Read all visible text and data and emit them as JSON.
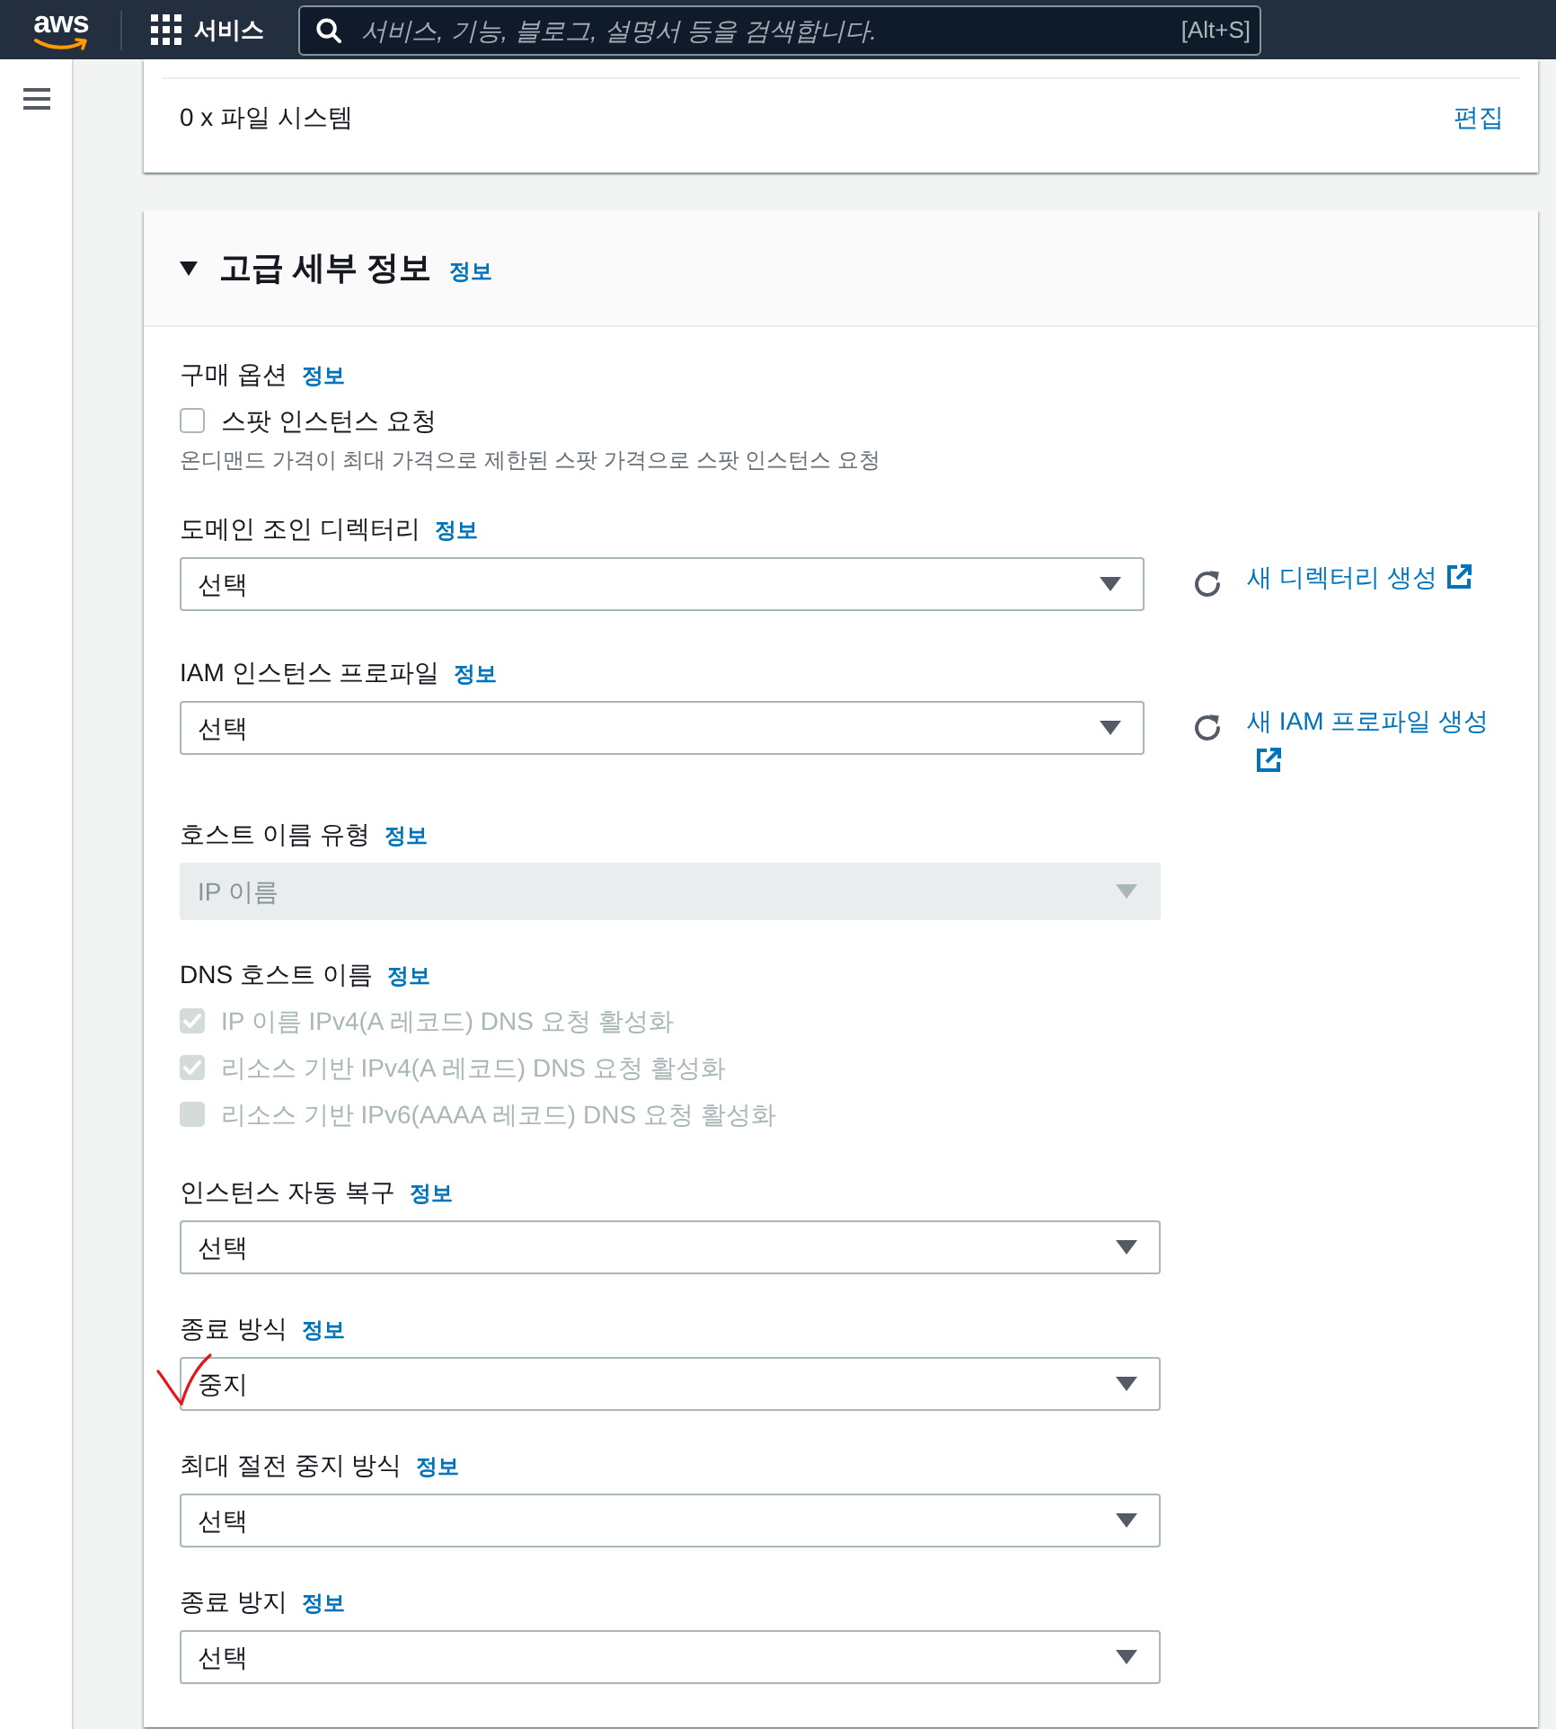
{
  "top_nav": {
    "logo_text": "aws",
    "services": "서비스",
    "search": {
      "placeholder": "서비스, 기능, 블로그, 설명서 등을 검색합니다.",
      "shortcut": "[Alt+S]"
    }
  },
  "storage_summary": {
    "text": "0 x 파일 시스템",
    "edit_link": "편집"
  },
  "advanced_details": {
    "title": "고급 세부 정보",
    "info": "정보",
    "expanded": true,
    "fields": [
      {
        "kind": "checkboxes",
        "label": "구매 옵션",
        "info": "정보",
        "options": [
          {
            "label": "스팟 인스턴스 요청",
            "checked": false,
            "disabled": false
          }
        ],
        "description": "온디맨드 가격이 최대 가격으로 제한된 스팟 가격으로 스팟 인스턴스 요청"
      },
      {
        "kind": "select",
        "label": "도메인 조인 디렉터리",
        "info": "정보",
        "value": "선택",
        "disabled": false,
        "create_link": "새 디렉터리 생성"
      },
      {
        "kind": "select",
        "label": "IAM 인스턴스 프로파일",
        "info": "정보",
        "value": "선택",
        "disabled": false,
        "create_link": "새 IAM 프로파일 생성"
      },
      {
        "kind": "select",
        "label": "호스트 이름 유형",
        "info": "정보",
        "value": "IP 이름",
        "disabled": true
      },
      {
        "kind": "checkboxes",
        "label": "DNS 호스트 이름",
        "info": "정보",
        "options": [
          {
            "label": "IP 이름 IPv4(A 레코드) DNS 요청 활성화",
            "checked": true,
            "disabled": true
          },
          {
            "label": "리소스 기반 IPv4(A 레코드) DNS 요청 활성화",
            "checked": true,
            "disabled": true
          },
          {
            "label": "리소스 기반 IPv6(AAAA 레코드) DNS 요청 활성화",
            "checked": false,
            "disabled": true
          }
        ]
      },
      {
        "kind": "select",
        "label": "인스턴스 자동 복구",
        "info": "정보",
        "value": "선택",
        "disabled": false
      },
      {
        "kind": "select",
        "label": "종료 방식",
        "info": "정보",
        "value": "중지",
        "disabled": false,
        "hand_marked": true
      },
      {
        "kind": "select",
        "label": "최대 절전 중지 방식",
        "info": "정보",
        "value": "선택",
        "disabled": false
      },
      {
        "kind": "select",
        "label": "종료 방지",
        "info": "정보",
        "value": "선택",
        "disabled": false
      }
    ]
  }
}
